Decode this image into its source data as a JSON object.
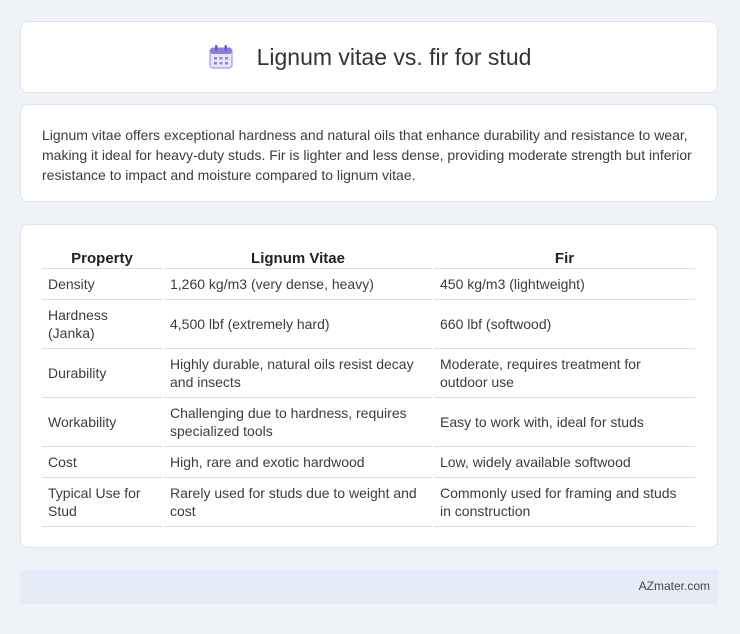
{
  "header": {
    "title": "Lignum vitae vs. fir for stud",
    "icon": "calendar-icon"
  },
  "description": "Lignum vitae offers exceptional hardness and natural oils that enhance durability and resistance to wear, making it ideal for heavy-duty studs. Fir is lighter and less dense, providing moderate strength but inferior resistance to impact and moisture compared to lignum vitae.",
  "table": {
    "headers": [
      "Property",
      "Lignum Vitae",
      "Fir"
    ],
    "rows": [
      [
        "Density",
        "1,260 kg/m3 (very dense, heavy)",
        "450 kg/m3 (lightweight)"
      ],
      [
        "Hardness (Janka)",
        "4,500 lbf (extremely hard)",
        "660 lbf (softwood)"
      ],
      [
        "Durability",
        "Highly durable, natural oils resist decay and insects",
        "Moderate, requires treatment for outdoor use"
      ],
      [
        "Workability",
        "Challenging due to hardness, requires specialized tools",
        "Easy to work with, ideal for studs"
      ],
      [
        "Cost",
        "High, rare and exotic hardwood",
        "Low, widely available softwood"
      ],
      [
        "Typical Use for Stud",
        "Rarely used for studs due to weight and cost",
        "Commonly used for framing and studs in construction"
      ]
    ]
  },
  "footer": {
    "brand": "AZmater.com"
  }
}
